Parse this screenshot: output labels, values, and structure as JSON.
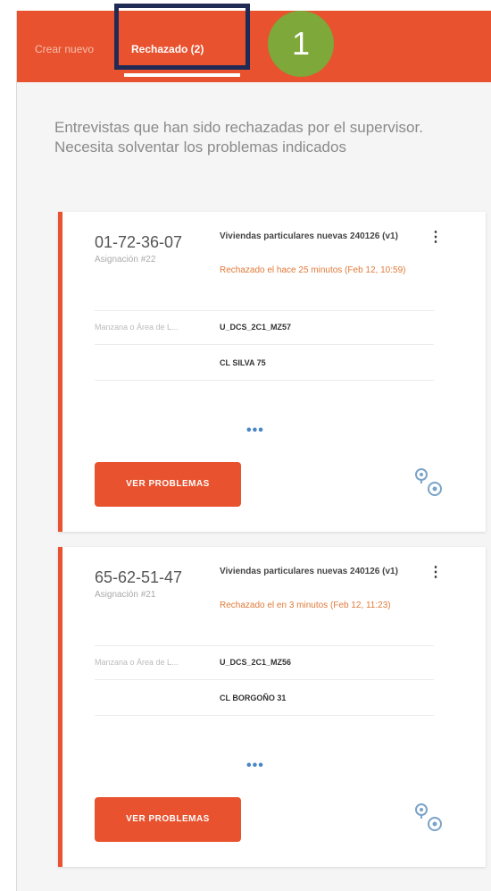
{
  "header": {
    "tab_create": "Crear nuevo",
    "tab_rejected": "Rechazado (2)",
    "step_number": "1"
  },
  "intro_text": "Entrevistas que han sido rechazadas por el supervisor. Necesita solventar los problemas indicados",
  "cards": [
    {
      "id": "01-72-36-07",
      "assignment": "Asignación #22",
      "title": "Viviendas particulares nuevas 240126 (v1)",
      "rejected": "Rechazado el hace 25 minutos (Feb 12, 10:59)",
      "field_key": "Manzana o Área de L...",
      "field_value": "U_DCS_2C1_MZ57",
      "address": "CL SILVA 75",
      "more": "•••",
      "button_label": "VER PROBLEMAS"
    },
    {
      "id": "65-62-51-47",
      "assignment": "Asignación #21",
      "title": "Viviendas particulares nuevas 240126 (v1)",
      "rejected": "Rechazado el en 3 minutos (Feb 12, 11:23)",
      "field_key": "Manzana o Área de L...",
      "field_value": "U_DCS_2C1_MZ56",
      "address": "CL BORGOÑO 31",
      "more": "•••",
      "button_label": "VER PROBLEMAS"
    }
  ],
  "colors": {
    "accent": "#e8522e",
    "highlight_border": "#1f2a55",
    "step_badge": "#7ea83a",
    "rejected_text": "#e07a3a",
    "link_blue": "#4a86c5"
  },
  "icons": [
    "menu-dots-icon",
    "map-pin-icon"
  ]
}
